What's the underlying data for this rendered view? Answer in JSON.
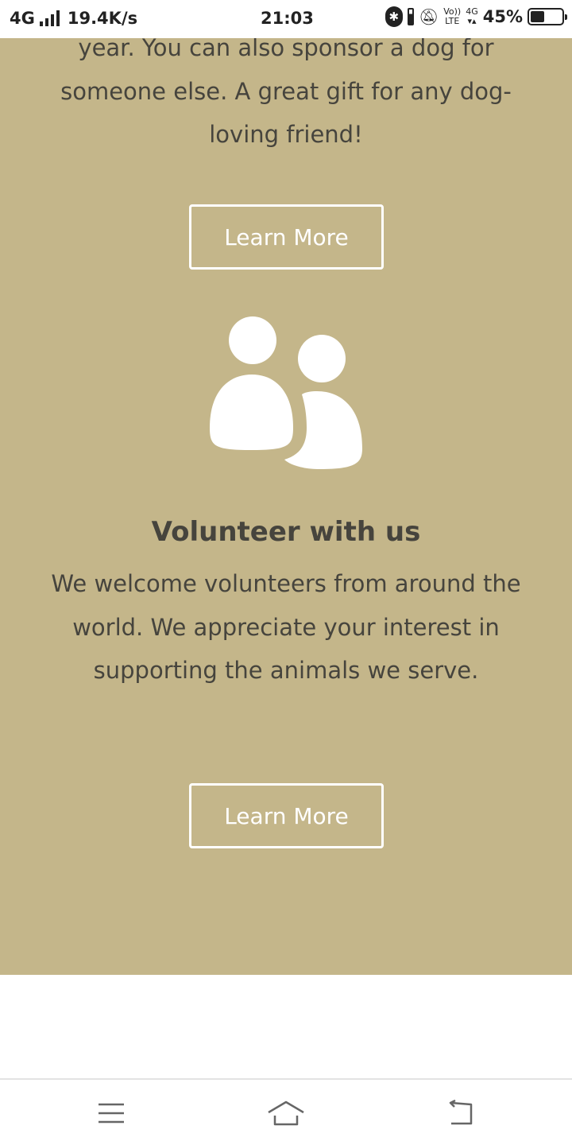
{
  "status_bar": {
    "network": "4G",
    "speed": "19.4K/s",
    "time": "21:03",
    "volte_top": "Vo))",
    "volte_bottom": "LTE",
    "net_type": "4G",
    "battery_percent": "45%",
    "battery_level": 0.45,
    "icons": [
      "signal-icon",
      "bluetooth-icon",
      "battery-saver-icon",
      "bell-off-icon",
      "volte-icon",
      "battery-icon"
    ]
  },
  "content": {
    "intro_text": "year. You can also sponsor a dog for someone else. A great gift for any dog-loving friend!",
    "sponsor_button": "Learn More",
    "volunteer_icon": "people-icon",
    "volunteer_heading": "Volunteer with us",
    "volunteer_text": "We welcome volunteers from around the world. We appreciate your interest in supporting the animals we serve.",
    "volunteer_button": "Learn More"
  },
  "nav_bar": {
    "icons": [
      "menu-icon",
      "home-icon",
      "back-icon"
    ]
  },
  "colors": {
    "panel_background": "#c4b68a",
    "body_text": "#46443d",
    "button_outline": "#ffffff",
    "page_background": "#ffffff"
  }
}
